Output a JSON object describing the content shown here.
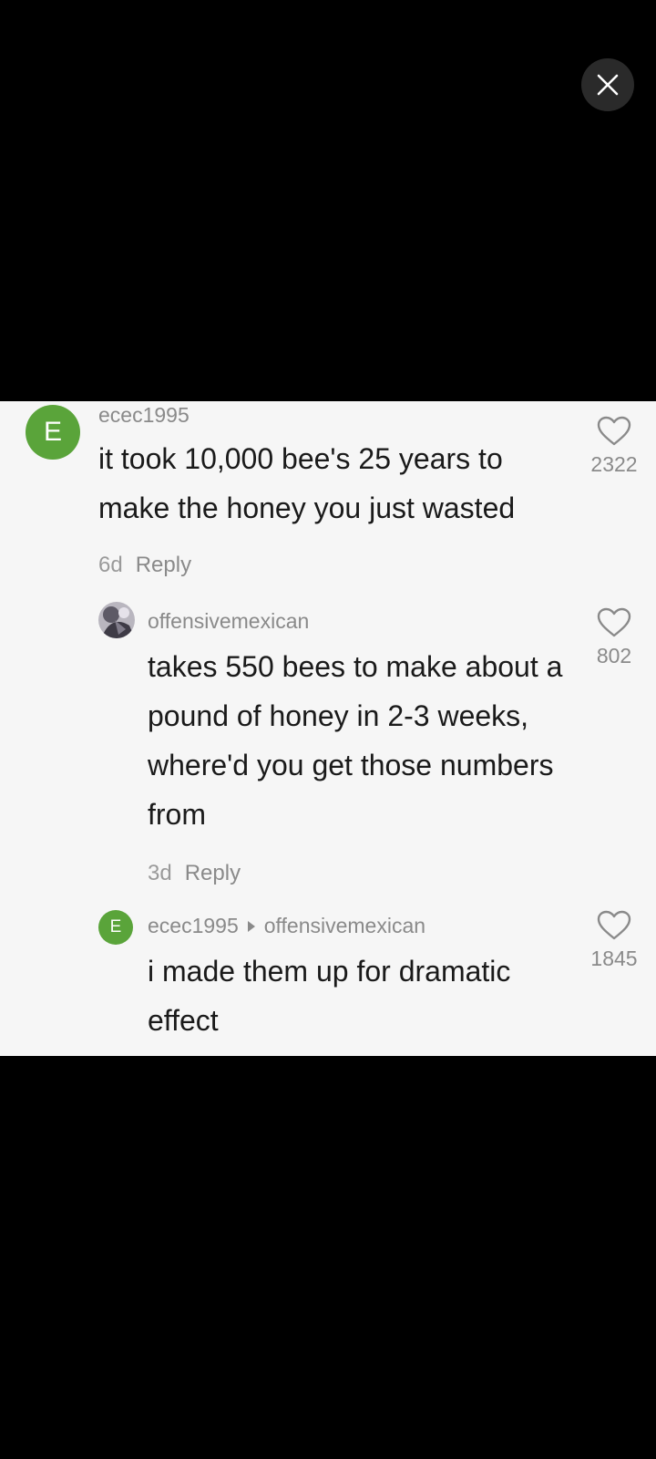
{
  "viewer": {
    "close_icon": "close-icon"
  },
  "comments": [
    {
      "avatar_letter": "E",
      "username": "ecec1995",
      "text": "it took 10,000 bee's 25 years to make the honey you just wasted",
      "age": "6d",
      "reply_label": "Reply",
      "likes": "2322"
    },
    {
      "username": "offensivemexican",
      "text": "takes 550 bees to make about a pound of honey in 2-3 weeks, where'd you get those numbers from",
      "age": "3d",
      "reply_label": "Reply",
      "likes": "802"
    },
    {
      "avatar_letter": "E",
      "username": "ecec1995",
      "reply_to": "offensivemexican",
      "text": "i made them up for dramatic effect",
      "likes": "1845"
    }
  ],
  "colors": {
    "background": "#000000",
    "panel": "#f6f6f6",
    "avatar_green": "#5aa43a"
  }
}
